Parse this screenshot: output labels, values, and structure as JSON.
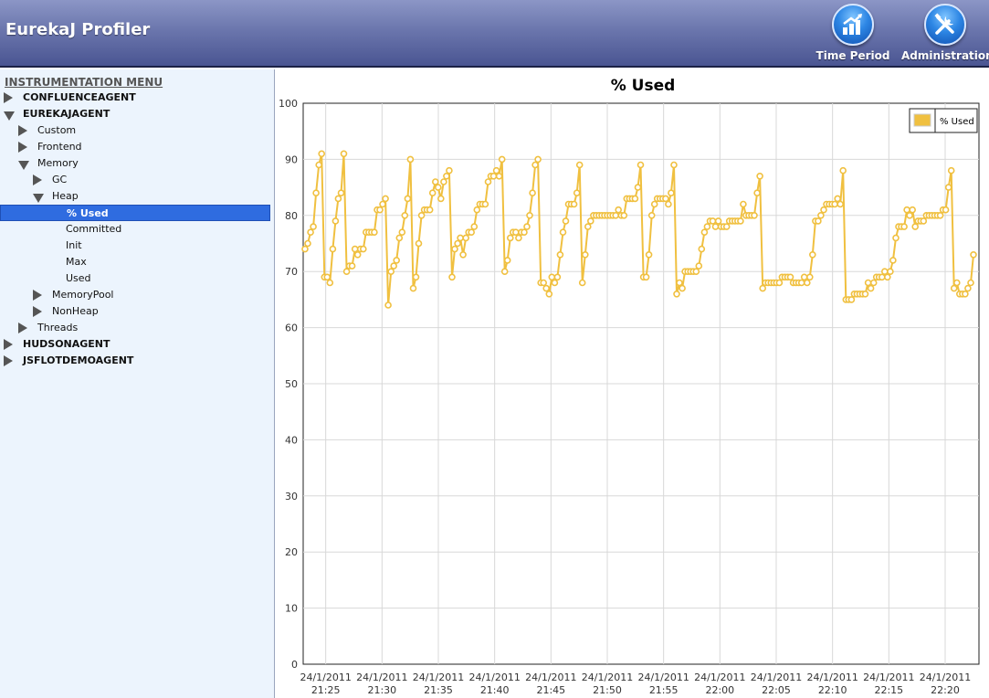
{
  "app": {
    "title": "EurekaJ Profiler"
  },
  "toolbar": {
    "time_period_label": "Time Period",
    "administration_label": "Administration"
  },
  "sidebar": {
    "title": "INSTRUMENTATION MENU",
    "items": [
      {
        "label": "CONFLUENCEAGENT",
        "state": "collapsed",
        "level": 0
      },
      {
        "label": "EUREKAJAGENT",
        "state": "expanded",
        "level": 0
      },
      {
        "label": "Custom",
        "state": "collapsed",
        "level": 1
      },
      {
        "label": "Frontend",
        "state": "collapsed",
        "level": 1
      },
      {
        "label": "Memory",
        "state": "expanded",
        "level": 1
      },
      {
        "label": "GC",
        "state": "collapsed",
        "level": 2
      },
      {
        "label": "Heap",
        "state": "expanded",
        "level": 2
      },
      {
        "label": "% Used",
        "state": "leaf",
        "level": 3,
        "selected": true
      },
      {
        "label": "Committed",
        "state": "leaf",
        "level": 3
      },
      {
        "label": "Init",
        "state": "leaf",
        "level": 3
      },
      {
        "label": "Max",
        "state": "leaf",
        "level": 3
      },
      {
        "label": "Used",
        "state": "leaf",
        "level": 3
      },
      {
        "label": "MemoryPool",
        "state": "collapsed",
        "level": 2
      },
      {
        "label": "NonHeap",
        "state": "collapsed",
        "level": 2
      },
      {
        "label": "Threads",
        "state": "collapsed",
        "level": 1
      },
      {
        "label": "HUDSONAGENT",
        "state": "collapsed",
        "level": 0
      },
      {
        "label": "JSFLOTDEMOAGENT",
        "state": "collapsed",
        "level": 0
      }
    ]
  },
  "colors": {
    "series": "#f0c040",
    "selection": "#2f6ce0"
  },
  "chart_data": {
    "type": "line",
    "title": "% Used",
    "legend": {
      "position": "top-right"
    },
    "grid": true,
    "ylim": [
      0,
      100
    ],
    "yticks": [
      0,
      10,
      20,
      30,
      40,
      50,
      60,
      70,
      80,
      90,
      100
    ],
    "xlim": [
      "24/1/2011 21:23",
      "24/1/2011 22:23"
    ],
    "xticks": [
      {
        "date": "24/1/2011",
        "time": "21:25"
      },
      {
        "date": "24/1/2011",
        "time": "21:30"
      },
      {
        "date": "24/1/2011",
        "time": "21:35"
      },
      {
        "date": "24/1/2011",
        "time": "21:40"
      },
      {
        "date": "24/1/2011",
        "time": "21:45"
      },
      {
        "date": "24/1/2011",
        "time": "21:50"
      },
      {
        "date": "24/1/2011",
        "time": "21:55"
      },
      {
        "date": "24/1/2011",
        "time": "22:00"
      },
      {
        "date": "24/1/2011",
        "time": "22:05"
      },
      {
        "date": "24/1/2011",
        "time": "22:10"
      },
      {
        "date": "24/1/2011",
        "time": "22:15"
      },
      {
        "date": "24/1/2011",
        "time": "22:20"
      }
    ],
    "series": [
      {
        "name": "% Used",
        "values": [
          74,
          75,
          77,
          78,
          84,
          89,
          91,
          69,
          69,
          68,
          74,
          79,
          83,
          84,
          91,
          70,
          71,
          71,
          74,
          73,
          74,
          74,
          77,
          77,
          77,
          77,
          81,
          81,
          82,
          83,
          64,
          70,
          71,
          72,
          76,
          77,
          80,
          83,
          90,
          67,
          69,
          75,
          80,
          81,
          81,
          81,
          84,
          86,
          85,
          83,
          86,
          87,
          88,
          69,
          74,
          75,
          76,
          73,
          76,
          77,
          77,
          78,
          81,
          82,
          82,
          82,
          86,
          87,
          87,
          88,
          87,
          90,
          70,
          72,
          76,
          77,
          77,
          76,
          77,
          77,
          78,
          80,
          84,
          89,
          90,
          68,
          68,
          67,
          66,
          69,
          68,
          69,
          73,
          77,
          79,
          82,
          82,
          82,
          84,
          89,
          68,
          73,
          78,
          79,
          80,
          80,
          80,
          80,
          80,
          80,
          80,
          80,
          80,
          81,
          80,
          80,
          83,
          83,
          83,
          83,
          85,
          89,
          69,
          69,
          73,
          80,
          82,
          83,
          83,
          83,
          83,
          82,
          84,
          89,
          66,
          68,
          67,
          70,
          70,
          70,
          70,
          70,
          71,
          74,
          77,
          78,
          79,
          79,
          78,
          79,
          78,
          78,
          78,
          79,
          79,
          79,
          79,
          79,
          82,
          80,
          80,
          80,
          80,
          84,
          87,
          67,
          68,
          68,
          68,
          68,
          68,
          68,
          69,
          69,
          69,
          69,
          68,
          68,
          68,
          68,
          69,
          68,
          69,
          73,
          79,
          79,
          80,
          81,
          82,
          82,
          82,
          82,
          83,
          82,
          88,
          65,
          65,
          65,
          66,
          66,
          66,
          66,
          66,
          68,
          67,
          68,
          69,
          69,
          69,
          70,
          69,
          70,
          72,
          76,
          78,
          78,
          78,
          81,
          80,
          81,
          78,
          79,
          79,
          79,
          80,
          80,
          80,
          80,
          80,
          80,
          81,
          81,
          85,
          88,
          67,
          68,
          66,
          66,
          66,
          67,
          68,
          73
        ]
      }
    ]
  }
}
